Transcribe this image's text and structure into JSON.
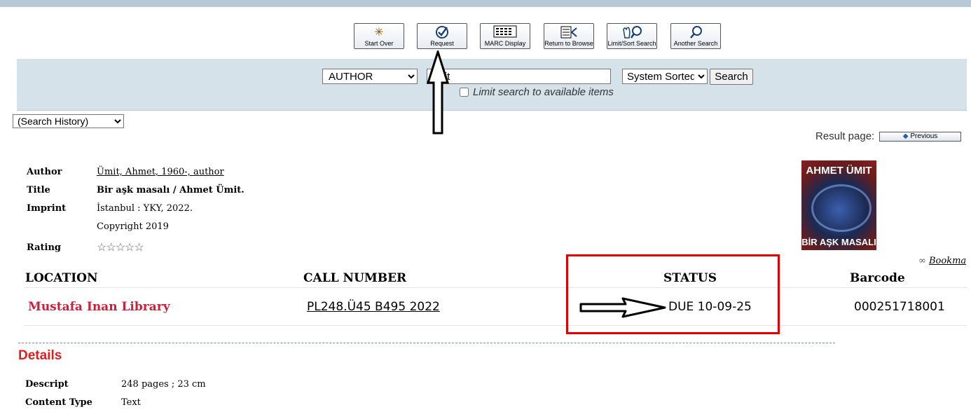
{
  "toolbar": {
    "buttons": [
      {
        "label": "Start Over",
        "icon": "start-over-icon"
      },
      {
        "label": "Request",
        "icon": "request-check-icon"
      },
      {
        "label": "MARC Display",
        "icon": "marc-grid-icon"
      },
      {
        "label": "Return to Browse",
        "icon": "return-browse-icon"
      },
      {
        "label": "Limit/Sort Search",
        "icon": "limit-sort-icon"
      },
      {
        "label": "Another Search",
        "icon": "magnifier-icon"
      }
    ]
  },
  "search": {
    "field_selected": "AUTHOR",
    "query_value": "ümit",
    "sort_selected": "System Sorted",
    "search_button": "Search",
    "limit_label": "Limit search to available items"
  },
  "history": {
    "selected": "(Search History)"
  },
  "pager": {
    "label": "Result page:",
    "previous": "Previous"
  },
  "record": {
    "labels": {
      "author": "Author",
      "title": "Title",
      "imprint": "Imprint",
      "rating": "Rating"
    },
    "author": "Ümit, Ahmet, 1960-, author",
    "title": "Bir aşk masalı / Ahmet Ümit.",
    "imprint": "İstanbul : YKY, 2022.",
    "copyright": "Copyright 2019",
    "rating_stars": "☆☆☆☆☆",
    "rating_value": 0,
    "cover": {
      "top_text": "AHMET ÜMIT",
      "bottom_text": "BİR AŞK MASALI"
    }
  },
  "bookmark": {
    "label": "Bookma"
  },
  "items": {
    "headers": [
      "LOCATION",
      "CALL NUMBER",
      "STATUS",
      "Barcode"
    ],
    "rows": [
      {
        "location": "Mustafa Inan Library",
        "call_number": "PL248.Ü45 B495 2022",
        "status": "DUE 10-09-25",
        "barcode": "000251718001"
      }
    ]
  },
  "details": {
    "title": "Details",
    "rows": [
      {
        "label": "Descript",
        "value": "248 pages ; 23 cm"
      },
      {
        "label": "Content Type",
        "value": "Text"
      }
    ]
  },
  "colors": {
    "location_red": "#cc1f38",
    "details_red": "#e02020",
    "band": "#d5e2ea",
    "annotation_red": "#e00000"
  }
}
